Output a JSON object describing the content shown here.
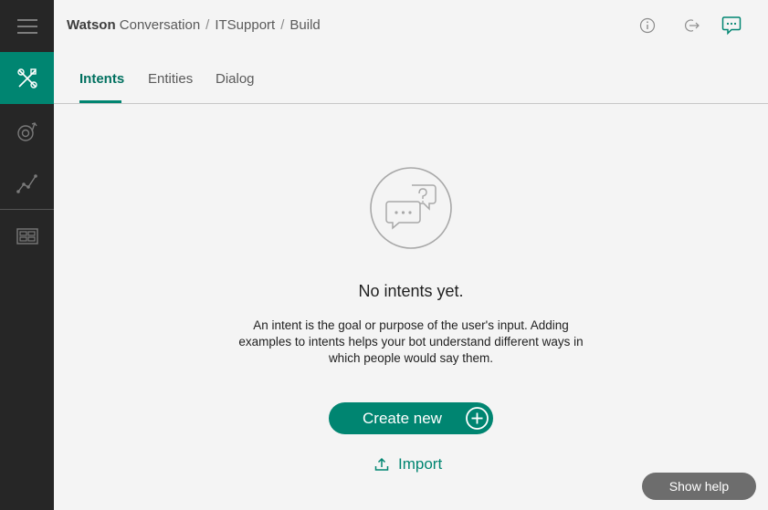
{
  "breadcrumb": {
    "brand": "Watson",
    "product": "Conversation",
    "separator": "/",
    "workspace": "ITSupport",
    "page": "Build"
  },
  "tabs": [
    {
      "label": "Intents",
      "active": true
    },
    {
      "label": "Entities",
      "active": false
    },
    {
      "label": "Dialog",
      "active": false
    }
  ],
  "sidebar": {
    "items": [
      {
        "icon": "hamburger-menu-icon"
      },
      {
        "icon": "tools-icon",
        "active": true
      },
      {
        "icon": "target-arrow-icon"
      },
      {
        "icon": "line-graph-icon"
      },
      {
        "icon": "workspaces-icon"
      }
    ]
  },
  "top_icons": [
    "info-icon",
    "exit-icon",
    "chat-icon"
  ],
  "empty_state": {
    "title": "No intents yet.",
    "description": "An intent is the goal or purpose of the user's input. Adding examples to intents helps your bot understand different ways in which people would say them.",
    "create_label": "Create new",
    "import_label": "Import"
  },
  "help": {
    "label": "Show help"
  },
  "colors": {
    "accent": "#008571",
    "sidebar": "#262626",
    "background": "#f4f4f4",
    "help_button": "#6d6d6d"
  }
}
